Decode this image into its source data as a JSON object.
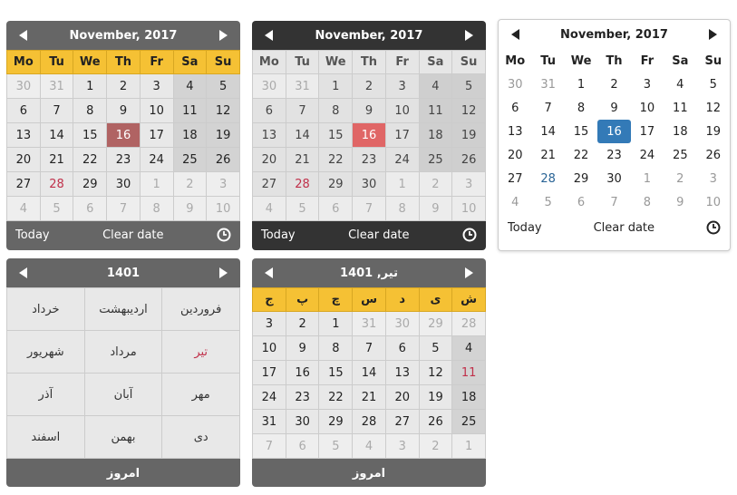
{
  "colors": {
    "header_yellow": "#f5c134",
    "panel_grey": "#666666",
    "panel_dark": "#333333",
    "active_red": "#b06363",
    "active_coral": "#e06666",
    "active_blue": "#337ab7",
    "holiday_red": "#c0304a"
  },
  "icons": {
    "prev": "triangle-left",
    "next": "triangle-right",
    "time": "clock"
  },
  "gregorian": {
    "title": "November, 2017",
    "weekdays": [
      "Mo",
      "Tu",
      "We",
      "Th",
      "Fr",
      "Sa",
      "Su"
    ],
    "weeks": [
      [
        {
          "d": "30",
          "old": true
        },
        {
          "d": "31",
          "old": true
        },
        {
          "d": "1"
        },
        {
          "d": "2"
        },
        {
          "d": "3"
        },
        {
          "d": "4",
          "we": true
        },
        {
          "d": "5",
          "we": true
        }
      ],
      [
        {
          "d": "6"
        },
        {
          "d": "7"
        },
        {
          "d": "8"
        },
        {
          "d": "9"
        },
        {
          "d": "10"
        },
        {
          "d": "11",
          "we": true
        },
        {
          "d": "12",
          "we": true
        }
      ],
      [
        {
          "d": "13"
        },
        {
          "d": "14"
        },
        {
          "d": "15"
        },
        {
          "d": "16",
          "active": true
        },
        {
          "d": "17"
        },
        {
          "d": "18",
          "we": true
        },
        {
          "d": "19",
          "we": true
        }
      ],
      [
        {
          "d": "20"
        },
        {
          "d": "21"
        },
        {
          "d": "22"
        },
        {
          "d": "23"
        },
        {
          "d": "24"
        },
        {
          "d": "25",
          "we": true
        },
        {
          "d": "26",
          "we": true
        }
      ],
      [
        {
          "d": "27"
        },
        {
          "d": "28",
          "holiday": true
        },
        {
          "d": "29"
        },
        {
          "d": "30"
        },
        {
          "d": "1",
          "old": true
        },
        {
          "d": "2",
          "old": true
        },
        {
          "d": "3",
          "old": true
        }
      ],
      [
        {
          "d": "4",
          "old": true
        },
        {
          "d": "5",
          "old": true
        },
        {
          "d": "6",
          "old": true
        },
        {
          "d": "7",
          "old": true
        },
        {
          "d": "8",
          "old": true
        },
        {
          "d": "9",
          "old": true
        },
        {
          "d": "10",
          "old": true
        }
      ]
    ],
    "today_label": "Today",
    "clear_label": "Clear date"
  },
  "persian_months": {
    "title": "1401",
    "rows": [
      [
        {
          "m": "فروردین"
        },
        {
          "m": "اردیبهشت"
        },
        {
          "m": "خرداد"
        }
      ],
      [
        {
          "m": "تیر",
          "current": true
        },
        {
          "m": "مرداد"
        },
        {
          "m": "شهریور"
        }
      ],
      [
        {
          "m": "مهر"
        },
        {
          "m": "آبان"
        },
        {
          "m": "آذر"
        }
      ],
      [
        {
          "m": "دی"
        },
        {
          "m": "بهمن"
        },
        {
          "m": "اسفند"
        }
      ]
    ],
    "today_label": "امروز"
  },
  "persian_days": {
    "title": "تیر, 1401",
    "weekdays": [
      "ش",
      "ی",
      "د",
      "س",
      "چ",
      "پ",
      "ج"
    ],
    "weeks": [
      [
        {
          "d": "28",
          "old": true
        },
        {
          "d": "29",
          "old": true
        },
        {
          "d": "30",
          "old": true
        },
        {
          "d": "31",
          "old": true
        },
        {
          "d": "1"
        },
        {
          "d": "2"
        },
        {
          "d": "3"
        }
      ],
      [
        {
          "d": "4",
          "we": true
        },
        {
          "d": "5"
        },
        {
          "d": "6"
        },
        {
          "d": "7"
        },
        {
          "d": "8"
        },
        {
          "d": "9"
        },
        {
          "d": "10"
        }
      ],
      [
        {
          "d": "11",
          "we": true,
          "holiday": true
        },
        {
          "d": "12"
        },
        {
          "d": "13"
        },
        {
          "d": "14"
        },
        {
          "d": "15"
        },
        {
          "d": "16"
        },
        {
          "d": "17"
        }
      ],
      [
        {
          "d": "18",
          "we": true
        },
        {
          "d": "19"
        },
        {
          "d": "20"
        },
        {
          "d": "21"
        },
        {
          "d": "22"
        },
        {
          "d": "23"
        },
        {
          "d": "24"
        }
      ],
      [
        {
          "d": "25",
          "we": true
        },
        {
          "d": "26"
        },
        {
          "d": "27"
        },
        {
          "d": "28"
        },
        {
          "d": "29"
        },
        {
          "d": "30"
        },
        {
          "d": "31"
        }
      ],
      [
        {
          "d": "1",
          "old": true
        },
        {
          "d": "2",
          "old": true
        },
        {
          "d": "3",
          "old": true
        },
        {
          "d": "4",
          "old": true
        },
        {
          "d": "5",
          "old": true
        },
        {
          "d": "6",
          "old": true
        },
        {
          "d": "7",
          "old": true
        }
      ]
    ],
    "today_label": "امروز"
  }
}
